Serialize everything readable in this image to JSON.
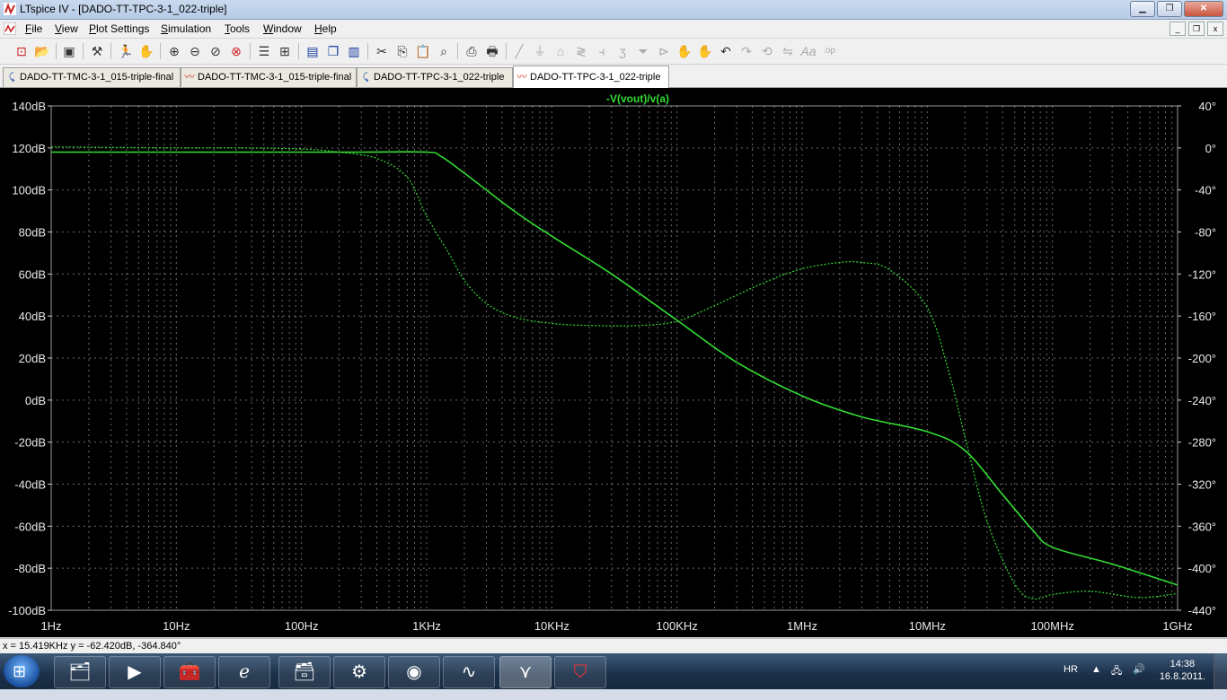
{
  "window": {
    "title": "LTspice IV - [DADO-TT-TPC-3-1_022-triple]"
  },
  "menu": [
    "File",
    "View",
    "Plot Settings",
    "Simulation",
    "Tools",
    "Window",
    "Help"
  ],
  "toolbar_icons": [
    "new-schematic-icon",
    "open-icon",
    "save-icon",
    "control-panel-icon",
    "run-icon",
    "halt-icon",
    "zoom-in-icon",
    "zoom-out-icon",
    "zoom-full-icon",
    "zoom-cancel-icon",
    "autorange-icon",
    "mark-icon",
    "tile-horizontal-icon",
    "cascade-icon",
    "tile-vertical-icon",
    "cut-icon",
    "copy-icon",
    "paste-icon",
    "find-icon",
    "print-preview-icon",
    "print-icon",
    "wire-icon",
    "ground-icon",
    "label-icon",
    "resistor-icon",
    "capacitor-icon",
    "inductor-icon",
    "diode-icon",
    "component-icon",
    "move-icon",
    "drag-icon",
    "undo-icon",
    "redo-icon",
    "rotate-icon",
    "mirror-icon",
    "text-icon",
    "spice-directive-icon"
  ],
  "tabs": [
    {
      "label": "DADO-TT-TMC-3-1_015-triple-final",
      "kind": "schematic",
      "active": false
    },
    {
      "label": "DADO-TT-TMC-3-1_015-triple-final",
      "kind": "waveform",
      "active": false
    },
    {
      "label": "DADO-TT-TPC-3-1_022-triple",
      "kind": "schematic",
      "active": false
    },
    {
      "label": "DADO-TT-TPC-3-1_022-triple",
      "kind": "waveform",
      "active": true
    }
  ],
  "chart_data": {
    "type": "line",
    "title": "-V(vout)/v(a)",
    "xscale": "log",
    "x_tick_labels": [
      "1Hz",
      "10Hz",
      "100Hz",
      "1KHz",
      "10KHz",
      "100KHz",
      "1MHz",
      "10MHz",
      "100MHz",
      "1GHz"
    ],
    "xlim": [
      1,
      1000000000
    ],
    "y_left_tick_labels": [
      "140dB",
      "120dB",
      "100dB",
      "80dB",
      "60dB",
      "40dB",
      "20dB",
      "0dB",
      "-20dB",
      "-40dB",
      "-60dB",
      "-80dB",
      "-100dB"
    ],
    "ylim_left": [
      -100,
      140
    ],
    "y_right_tick_labels": [
      "40°",
      "0°",
      "-40°",
      "-80°",
      "-120°",
      "-160°",
      "-200°",
      "-240°",
      "-280°",
      "-320°",
      "-360°",
      "-400°",
      "-440°"
    ],
    "ylim_right": [
      -440,
      40
    ],
    "grid": true,
    "trace_color": "#33dd33",
    "series": [
      {
        "quantity": "magnitude (dB)",
        "style": "solid",
        "x": [
          1,
          10,
          100,
          300,
          1000,
          1300,
          2000,
          5000,
          10000,
          30000,
          100000,
          300000,
          1000000,
          3000000,
          10000000,
          20000000,
          40000000,
          70000000,
          100000000,
          300000000,
          1000000000
        ],
        "y": [
          118,
          118,
          118,
          118,
          118,
          116,
          108,
          90,
          78,
          60,
          38,
          18,
          2,
          -8,
          -15,
          -24,
          -45,
          -62,
          -70,
          -78,
          -88
        ]
      },
      {
        "quantity": "phase (°)",
        "style": "dashed",
        "x": [
          1,
          10,
          30,
          100,
          200,
          400,
          700,
          1000,
          1500,
          2000,
          3000,
          5000,
          10000,
          20000,
          50000,
          100000,
          200000,
          500000,
          1000000,
          2000000,
          3000000,
          5000000,
          10000000,
          15000000,
          20000000,
          30000000,
          50000000,
          70000000,
          100000000,
          200000000,
          500000000,
          1000000000
        ],
        "y": [
          1,
          0,
          0,
          -1,
          -4,
          -10,
          -28,
          -65,
          -100,
          -126,
          -148,
          -161,
          -167,
          -169,
          -169,
          -165,
          -150,
          -128,
          -115,
          -109,
          -109,
          -116,
          -152,
          -215,
          -275,
          -355,
          -415,
          -429,
          -425,
          -422,
          -428,
          -424
        ]
      }
    ]
  },
  "status": {
    "cursor_readout": "x = 15.419KHz   y = -62.420dB, -364.840°"
  },
  "tray": {
    "language": "HR",
    "time": "14:38",
    "date": "16.8.2011."
  },
  "taskbar_apps": [
    "explorer-icon",
    "media-player-icon",
    "folder-tools-icon",
    "internet-explorer-icon",
    "file-manager-icon",
    "device-icon",
    "antivirus-icon",
    "oscilloscope-icon",
    "ltspice-icon",
    "pdf-reader-icon"
  ]
}
